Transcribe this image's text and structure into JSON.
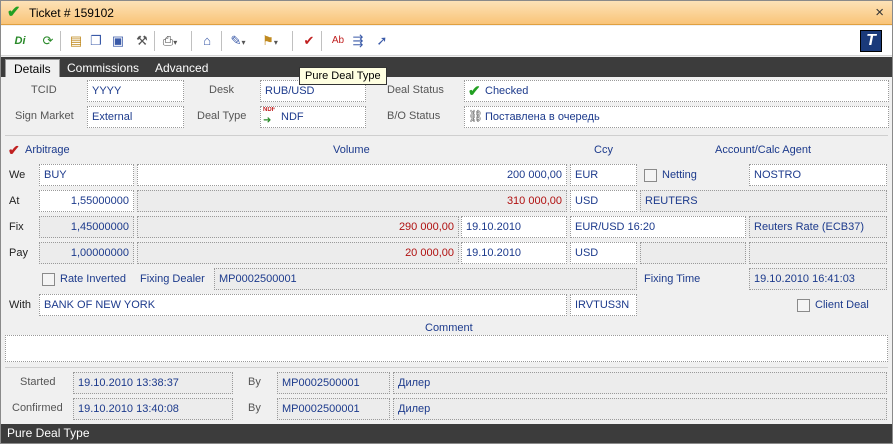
{
  "window": {
    "title": "Ticket # 159102",
    "close_glyph": "×"
  },
  "toolbar": {
    "tooltip": "Pure Deal Type",
    "icons": [
      "di-icon",
      "refresh-icon",
      "open-icon",
      "copy-icon",
      "paste-icon",
      "tools-icon",
      "print-icon",
      "export-icon",
      "edit-icon",
      "flag-icon",
      "check-deal-icon",
      "ab-icon",
      "split-icon",
      "route-icon",
      "t-logo-icon"
    ]
  },
  "tabs": [
    {
      "label": "Details"
    },
    {
      "label": "Commissions"
    },
    {
      "label": "Advanced"
    }
  ],
  "header": {
    "tcid_label": "TCID",
    "tcid": "YYYY",
    "desk_label": "Desk",
    "desk": "RUB/USD",
    "deal_status_label": "Deal Status",
    "deal_status": "Checked",
    "sign_market_label": "Sign Market",
    "sign_market": "External",
    "deal_type_label": "Deal Type",
    "deal_type": "NDF",
    "deal_type_badge": "NDF",
    "bo_status_label": "B/O Status",
    "bo_status": "Поставлена в очередь"
  },
  "grid": {
    "arbitrage_label": "Arbitrage",
    "volume_label": "Volume",
    "ccy_label": "Ccy",
    "account_label": "Account/Calc Agent",
    "we_label": "We",
    "we_side": "BUY",
    "we_volume": "200 000,00",
    "we_ccy": "EUR",
    "netting_label": "Netting",
    "account": "NOSTRO",
    "at_label": "At",
    "at_rate": "1,55000000",
    "at_volume": "310 000,00",
    "at_ccy": "USD",
    "at_source": "REUTERS",
    "fix_label": "Fix",
    "fix_rate": "1,45000000",
    "fix_amount": "290 000,00",
    "fix_date": "19.10.2010",
    "fix_pair": "EUR/USD 16:20",
    "fix_source": "Reuters Rate (ECB37)",
    "pay_label": "Pay",
    "pay_rate": "1,00000000",
    "pay_amount": "20 000,00",
    "pay_date": "19.10.2010",
    "pay_ccy": "USD",
    "rate_inverted_label": "Rate Inverted",
    "fixing_dealer_label": "Fixing Dealer",
    "fixing_dealer": "MP0002500001",
    "fixing_time_label": "Fixing Time",
    "fixing_time": "19.10.2010 16:41:03",
    "with_label": "With",
    "counterparty": "BANK OF NEW YORK",
    "swift": "IRVTUS3N",
    "client_deal_label": "Client Deal"
  },
  "comment": {
    "label": "Comment",
    "value": ""
  },
  "audit": {
    "started_label": "Started",
    "started": "19.10.2010 13:38:37",
    "started_by_label": "By",
    "started_by": "MP0002500001",
    "started_role": "Дилер",
    "confirmed_label": "Confirmed",
    "confirmed": "19.10.2010 13:40:08",
    "confirmed_by_label": "By",
    "confirmed_by": "MP0002500001",
    "confirmed_role": "Дилер"
  },
  "statusbar": {
    "text": "Pure Deal Type"
  }
}
